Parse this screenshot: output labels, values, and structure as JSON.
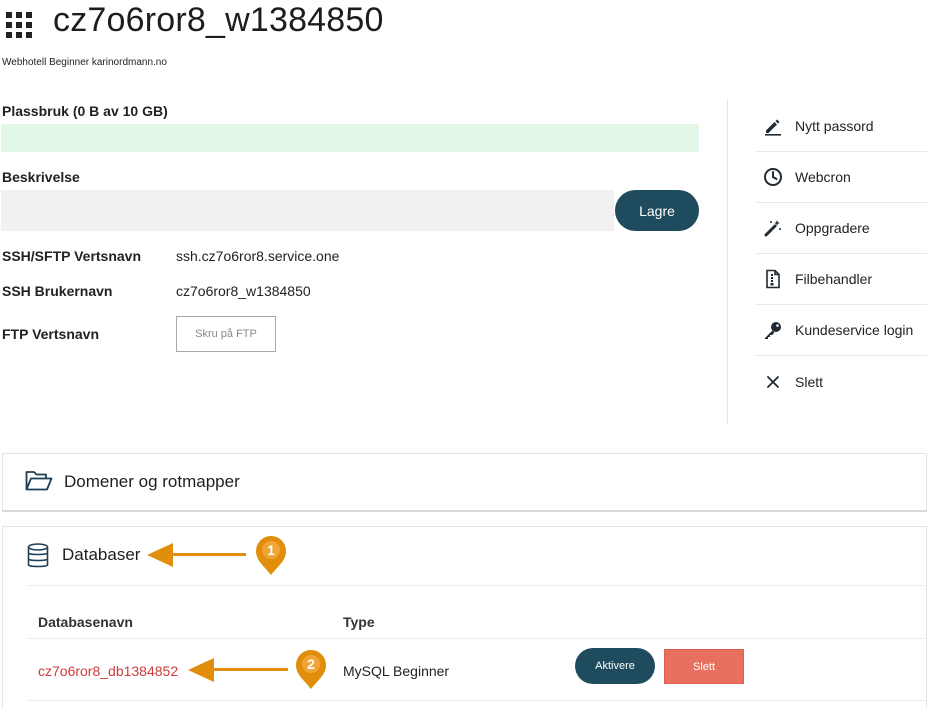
{
  "header": {
    "title": "cz7o6ror8_w1384850",
    "subtitle": "Webhotell Beginner karinordmann.no"
  },
  "usage": {
    "label": "Plassbruk (0 B av 10 GB)",
    "fraction": 0
  },
  "description": {
    "label": "Beskrivelse",
    "value": "",
    "save_label": "Lagre"
  },
  "info": [
    {
      "label": "SSH/SFTP Vertsnavn",
      "value": "ssh.cz7o6ror8.service.one"
    },
    {
      "label": "SSH Brukernavn",
      "value": "cz7o6ror8_w1384850"
    },
    {
      "label": "FTP Vertsnavn",
      "button": "Skru på FTP"
    }
  ],
  "actions": [
    {
      "label": "Nytt passord",
      "icon": "pencil-icon"
    },
    {
      "label": "Webcron",
      "icon": "clock-icon"
    },
    {
      "label": "Oppgradere",
      "icon": "magic-wand-icon"
    },
    {
      "label": "Filbehandler",
      "icon": "file-icon"
    },
    {
      "label": "Kundeservice login",
      "icon": "key-icon"
    },
    {
      "label": "Slett",
      "icon": "close-icon"
    }
  ],
  "domains": {
    "title": "Domener og rotmapper",
    "icon": "folder-open-icon"
  },
  "databases": {
    "title": "Databaser",
    "icon": "database-icon",
    "columns": [
      "Databasenavn",
      "Type"
    ],
    "rows": [
      {
        "name": "cz7o6ror8_db1384852",
        "type": "MySQL Beginner",
        "activate_label": "Aktivere",
        "delete_label": "Slett"
      }
    ]
  },
  "annotations": [
    {
      "number": "1"
    },
    {
      "number": "2"
    }
  ],
  "colors": {
    "primary": "#1f4b5e",
    "danger": "#e8705f",
    "link": "#d23a3a",
    "annotation": "#e08e0b",
    "usage_bar": "#e3f7e9"
  }
}
